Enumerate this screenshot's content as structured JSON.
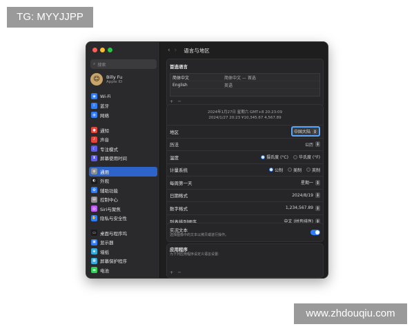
{
  "watermark_top": "TG: MYYJJPP",
  "watermark_bottom": "www.zhdouqiu.com",
  "window": {
    "traffic_colors": [
      "#ff5f57",
      "#febc2e",
      "#28c840"
    ]
  },
  "sidebar": {
    "search_placeholder": "搜索",
    "user": {
      "name": "Billy Fu",
      "sub": "Apple ID"
    },
    "groups": [
      [
        {
          "label": "Wi-Fi",
          "icon": "wifi-icon",
          "color": "#2e7cf6",
          "glyph": "◉"
        },
        {
          "label": "蓝牙",
          "icon": "bluetooth-icon",
          "color": "#2e7cf6",
          "glyph": "ᛒ"
        },
        {
          "label": "网络",
          "icon": "network-icon",
          "color": "#2e7cf6",
          "glyph": "◍"
        }
      ],
      [
        {
          "label": "通知",
          "icon": "bell-icon",
          "color": "#e5443a",
          "glyph": "●"
        },
        {
          "label": "声音",
          "icon": "speaker-icon",
          "color": "#e5443a",
          "glyph": "♪"
        },
        {
          "label": "专注模式",
          "icon": "moon-icon",
          "color": "#5e5ce6",
          "glyph": "☾"
        },
        {
          "label": "屏幕使用时间",
          "icon": "hourglass-icon",
          "color": "#5e5ce6",
          "glyph": "⧗"
        }
      ],
      [
        {
          "label": "通用",
          "icon": "gear-icon",
          "color": "#8e8e93",
          "glyph": "⚙",
          "active": true
        },
        {
          "label": "外观",
          "icon": "appearance-icon",
          "color": "#1c1c1e",
          "glyph": "◐"
        },
        {
          "label": "辅助功能",
          "icon": "accessibility-icon",
          "color": "#2e7cf6",
          "glyph": "✪"
        },
        {
          "label": "控制中心",
          "icon": "control-center-icon",
          "color": "#8e8e93",
          "glyph": "▤"
        },
        {
          "label": "Siri与聚焦",
          "icon": "siri-icon",
          "color": "#bf5af2",
          "glyph": "◎"
        },
        {
          "label": "隐私与安全性",
          "icon": "hand-icon",
          "color": "#2e7cf6",
          "glyph": "✋"
        }
      ],
      [
        {
          "label": "桌面与程序坞",
          "icon": "dock-icon",
          "color": "#1c1c1e",
          "glyph": "▭"
        },
        {
          "label": "显示器",
          "icon": "display-icon",
          "color": "#2e7cf6",
          "glyph": "▣"
        },
        {
          "label": "墙纸",
          "icon": "wallpaper-icon",
          "color": "#34aadc",
          "glyph": "❀"
        },
        {
          "label": "屏幕保护程序",
          "icon": "screensaver-icon",
          "color": "#34aadc",
          "glyph": "▦"
        },
        {
          "label": "电池",
          "icon": "battery-icon",
          "color": "#30d158",
          "glyph": "▬"
        }
      ]
    ]
  },
  "main": {
    "title": "语言与地区",
    "preferred": {
      "heading": "首选语言",
      "languages": [
        {
          "name": "简体中文",
          "desc": "简体中文 — 首选"
        },
        {
          "name": "English",
          "desc": "英语"
        }
      ],
      "add": "+",
      "remove": "−"
    },
    "preview": {
      "line1": "2024年1月27日 星期六 GMT+8 20:23:09",
      "line2": "2024/1/27 20:23     ¥10,345.67     4,567.89"
    },
    "settings": {
      "region": {
        "label": "地区",
        "value": "中国大陆"
      },
      "calendar": {
        "label": "历法",
        "value": "公历"
      },
      "temperature": {
        "label": "温度",
        "options": [
          "摄氏度 (°C)",
          "华氏度 (°F)"
        ],
        "selected": 0
      },
      "measurement": {
        "label": "计量系统",
        "options": [
          "公制",
          "美制",
          "英制"
        ],
        "selected": 0
      },
      "first_day": {
        "label": "每周第一天",
        "value": "星期一"
      },
      "date_format": {
        "label": "日期格式",
        "value": "2024/8/19"
      },
      "number_format": {
        "label": "数字格式",
        "value": "1,234,567.89"
      },
      "sort_order": {
        "label": "列表排列顺序",
        "value": "中文 (拼音排序)"
      }
    },
    "live_text": {
      "label": "实况文本",
      "sub": "选择图像中的文本以拷贝或进行操作。",
      "on": true
    },
    "apps": {
      "heading": "应用程序",
      "sub": "为下列应用程序设定义语言设置:",
      "add": "+",
      "remove": "−"
    }
  }
}
